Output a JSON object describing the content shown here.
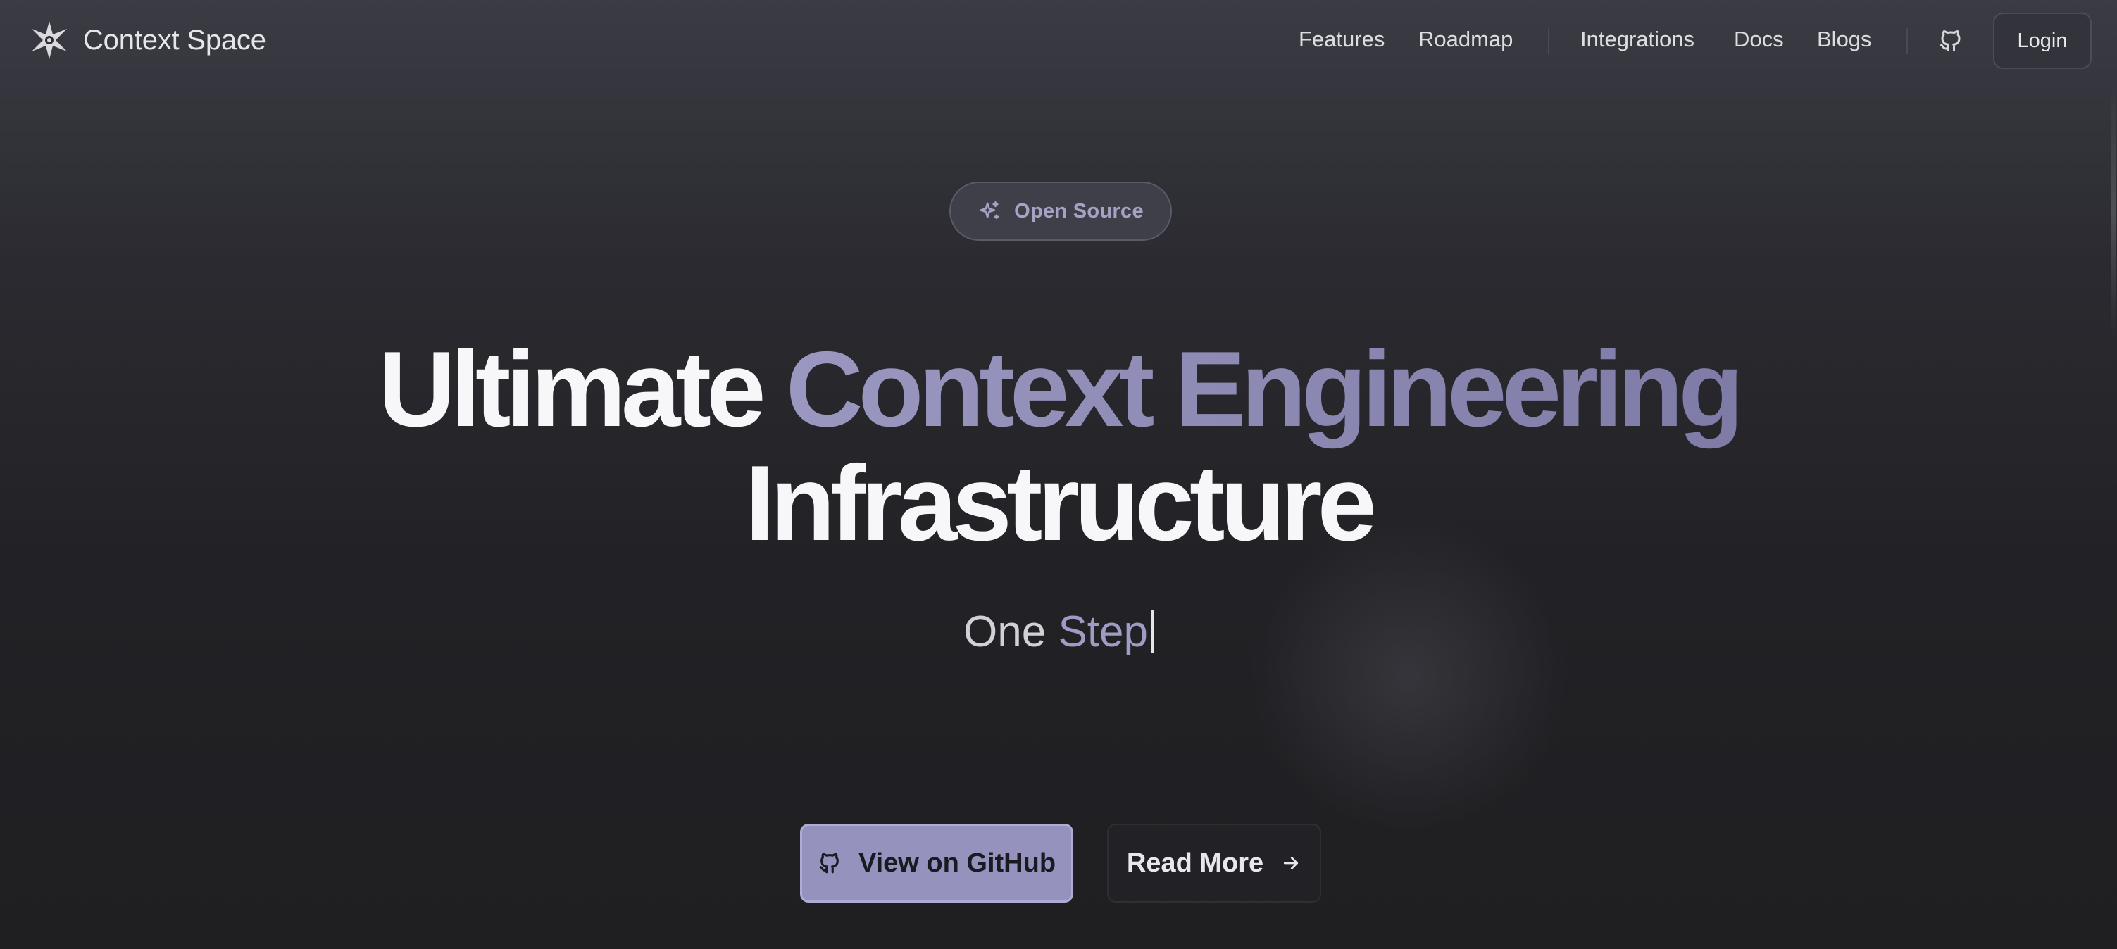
{
  "brand": {
    "name": "Context Space",
    "logo_icon": "sparkle-star-icon"
  },
  "nav": {
    "items": [
      {
        "label": "Features"
      },
      {
        "label": "Roadmap"
      },
      {
        "label": "Integrations"
      },
      {
        "label": "Docs"
      },
      {
        "label": "Blogs"
      }
    ],
    "github_icon": "github-icon",
    "login_label": "Login"
  },
  "badge": {
    "icon": "sparkles-icon",
    "label": "Open Source"
  },
  "hero": {
    "line1_white": "Ultimate",
    "line1_accent": "Context Engineering",
    "line2": "Infrastructure"
  },
  "tagline": {
    "prefix": "One",
    "accent": "Step"
  },
  "cta": {
    "github_label": "View on GitHub",
    "github_icon": "github-icon",
    "read_more_label": "Read More",
    "read_more_icon": "arrow-right-icon"
  },
  "colors": {
    "accent": "#9593bd",
    "accent_text": "#9e9cc4",
    "background": "#1f1f22"
  }
}
